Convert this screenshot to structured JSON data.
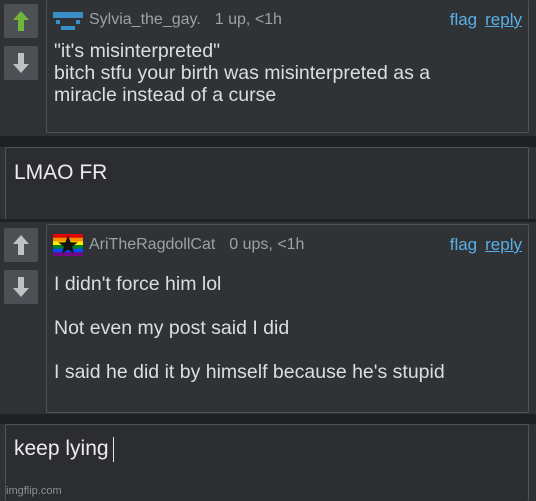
{
  "comments": [
    {
      "username": "Sylvia_the_gay.",
      "points": "1 up, <1h",
      "flag_label": "flag",
      "reply_label": "reply",
      "avatar_icon": "pixel-face-avatar-icon",
      "lines": [
        "\"it's misinterpreted\"",
        "bitch stfu your birth was misinterpreted as a",
        "miracle instead of a curse"
      ]
    },
    {
      "username": "AriTheRagdollCat",
      "points": "0 ups, <1h",
      "flag_label": "flag",
      "reply_label": "reply",
      "avatar_icon": "rainbow-flag-star-avatar-icon",
      "paragraphs": [
        "I didn't force him lol",
        "Not even my post said I did",
        "I said he did it by himself because he's stupid"
      ]
    }
  ],
  "replies": [
    {
      "text": "LMAO FR"
    },
    {
      "text": "keep lying"
    }
  ],
  "watermark": "imgflip.com",
  "colors": {
    "upvote": "#6fb63a",
    "downvote": "#bfc2c5",
    "link": "#5aaee5",
    "text": "#dcdddf",
    "meta": "#9da1a5",
    "background": "#2f3135"
  }
}
